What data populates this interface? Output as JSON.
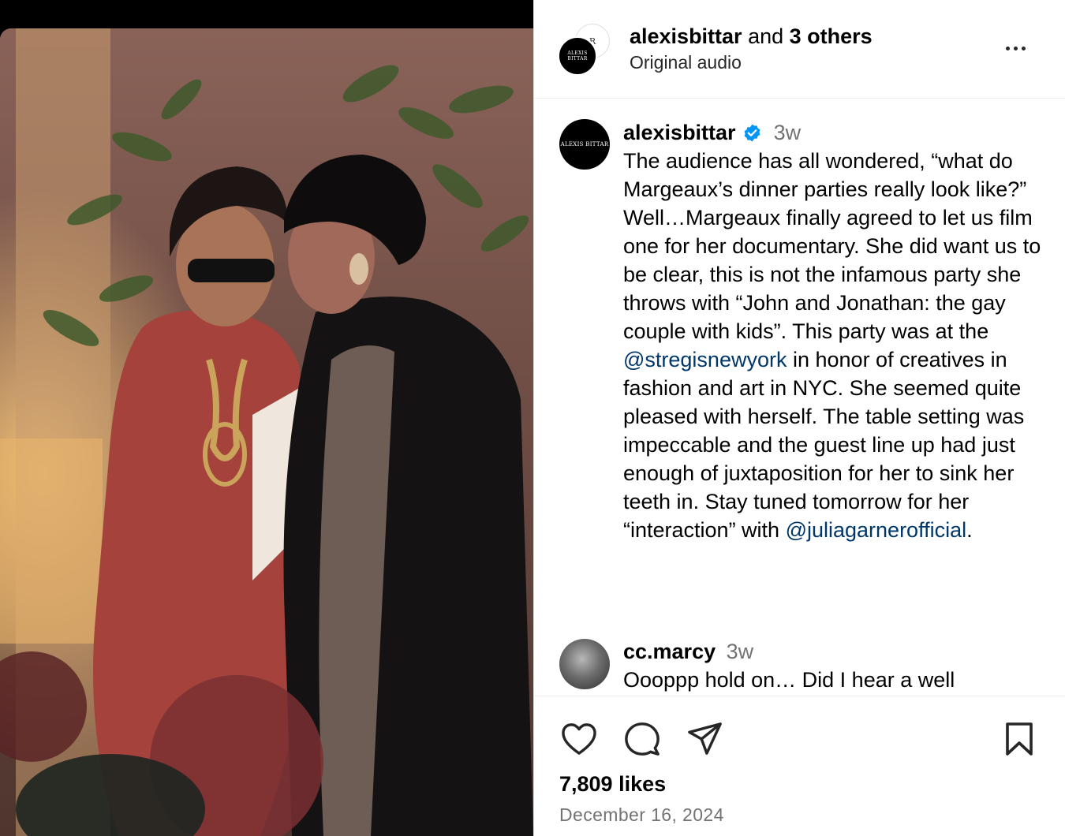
{
  "header": {
    "username": "alexisbittar",
    "connector": " and ",
    "others": "3 others",
    "audio": "Original audio",
    "small_avatar_text": "R",
    "main_avatar_text": "ALEXIS BITTAR"
  },
  "caption": {
    "avatar_text": "ALEXIS BITTAR",
    "username": "alexisbittar",
    "time": "3w",
    "text_before_mention_1": "The audience has all wondered, “what do Margeaux’s dinner parties really look like?” Well…Margeaux finally agreed to let us film one for her documentary. She did want us to be clear, this is not the infamous party she throws with “John and Jonathan: the gay couple with kids”. This party was at the ",
    "mention_1": "@stregisnewyork",
    "text_between_mentions": " in honor of creatives in fashion and art in NYC. She seemed quite pleased with herself. The table setting was impeccable and the guest line up had just enough of juxtaposition for her to sink her teeth in. Stay tuned tomorrow for her “interaction” with ",
    "mention_2": "@juliagarnerofficial",
    "text_after": "."
  },
  "comment": {
    "username": "cc.marcy",
    "time": "3w",
    "text": "Oooppp hold on… Did I hear a well"
  },
  "footer": {
    "likes": "7,809 likes",
    "date": "December 16, 2024"
  },
  "icons": [
    "more-icon",
    "verified-icon",
    "heart-icon",
    "comment-icon",
    "share-icon",
    "bookmark-icon"
  ],
  "colors": {
    "mention": "#00376b",
    "verified": "#0095f6",
    "secondary_text": "#737373"
  }
}
